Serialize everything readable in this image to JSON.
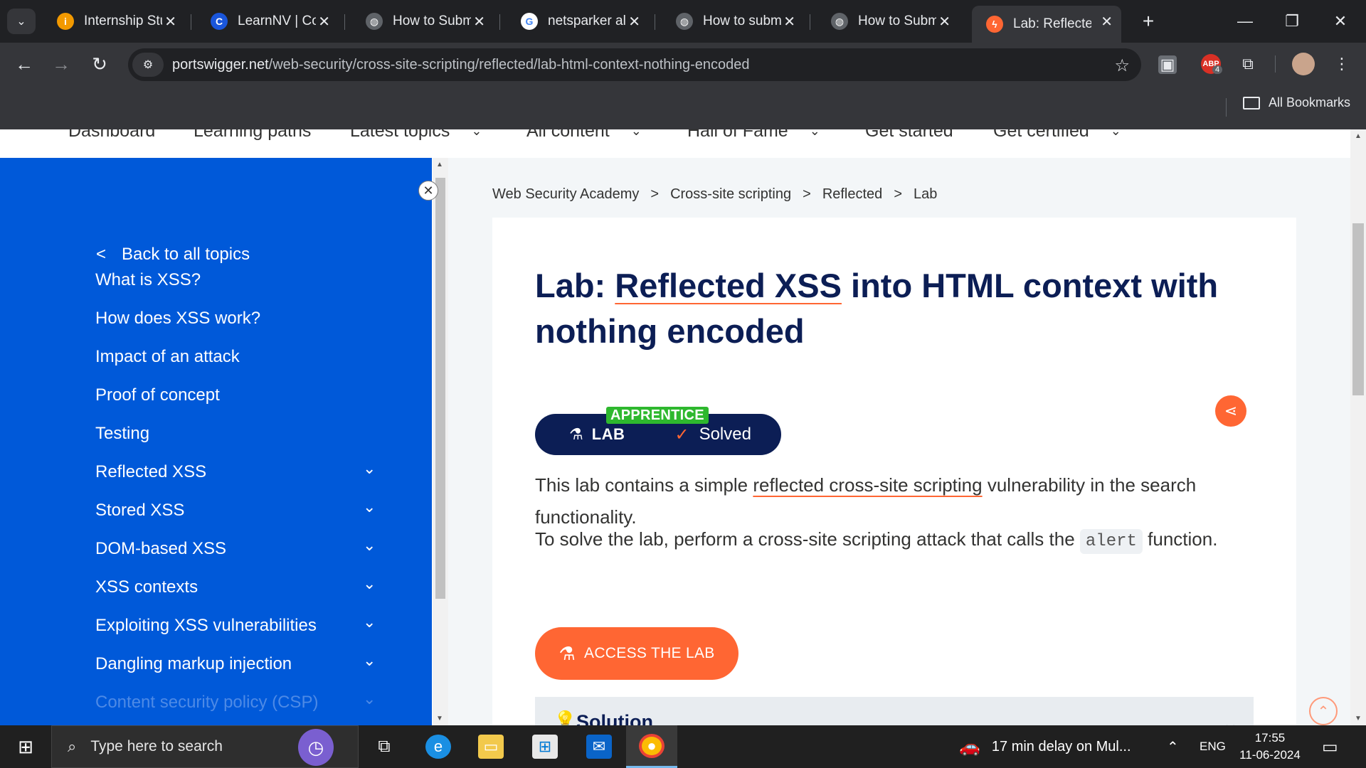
{
  "browser": {
    "tabs": [
      {
        "label": "Internship Stu",
        "icon": "info-icon",
        "color": "#f29900",
        "glyph": "i"
      },
      {
        "label": "LearnNV | Cou",
        "icon": "coursera-icon",
        "color": "#1a56db",
        "glyph": "C"
      },
      {
        "label": "How to Submi",
        "icon": "globe-icon",
        "color": "#5f6368",
        "glyph": "◍"
      },
      {
        "label": "netsparker alt",
        "icon": "google-icon",
        "color": "#ffffff",
        "glyph": "G"
      },
      {
        "label": "How to submi",
        "icon": "globe-icon",
        "color": "#5f6368",
        "glyph": "◍"
      },
      {
        "label": "How to Submi",
        "icon": "globe-icon",
        "color": "#5f6368",
        "glyph": "◍"
      },
      {
        "label": "Lab: Reflected",
        "icon": "portswigger-icon",
        "color": "#ff6633",
        "glyph": "ϟ",
        "active": true
      }
    ],
    "url_host": "portswigger.net",
    "url_path": "/web-security/cross-site-scripting/reflected/lab-html-context-nothing-encoded",
    "ext_badge": "4",
    "bookmarks_label": "All Bookmarks"
  },
  "topnav": [
    {
      "label": "Dashboard",
      "dropdown": false
    },
    {
      "label": "Learning paths",
      "dropdown": false
    },
    {
      "label": "Latest topics",
      "dropdown": true
    },
    {
      "label": "All content",
      "dropdown": true
    },
    {
      "label": "Hall of Fame",
      "dropdown": true
    },
    {
      "label": "Get started",
      "dropdown": false
    },
    {
      "label": "Get certified",
      "dropdown": true
    }
  ],
  "sidebar": {
    "back_label": "Back to all topics",
    "items": [
      {
        "label": "What is XSS?",
        "expandable": false
      },
      {
        "label": "How does XSS work?",
        "expandable": false
      },
      {
        "label": "Impact of an attack",
        "expandable": false
      },
      {
        "label": "Proof of concept",
        "expandable": false
      },
      {
        "label": "Testing",
        "expandable": false
      },
      {
        "label": "Reflected XSS",
        "expandable": true
      },
      {
        "label": "Stored XSS",
        "expandable": true
      },
      {
        "label": "DOM-based XSS",
        "expandable": true
      },
      {
        "label": "XSS contexts",
        "expandable": true
      },
      {
        "label": "Exploiting XSS vulnerabilities",
        "expandable": true
      },
      {
        "label": "Dangling markup injection",
        "expandable": true
      },
      {
        "label": "Content security policy (CSP)",
        "expandable": true
      }
    ]
  },
  "breadcrumb": [
    "Web Security Academy",
    "Cross-site scripting",
    "Reflected",
    "Lab"
  ],
  "breadcrumb_sep": ">",
  "lab": {
    "title_prefix": "Lab: ",
    "title_link": "Reflected XSS",
    "title_rest": " into HTML context with nothing encoded",
    "level": "APPRENTICE",
    "pill_label": "LAB",
    "status": "Solved",
    "desc_before": "This lab contains a simple ",
    "desc_link": "reflected cross-site scripting",
    "desc_after": " vulnerability in the search functionality.",
    "task_before": "To solve the lab, perform a cross-site scripting attack that calls the ",
    "task_code": "alert",
    "task_after": " function.",
    "access_label": "ACCESS THE LAB",
    "solution_label": "Solution"
  },
  "taskbar": {
    "search_placeholder": "Type here to search",
    "notification": "17 min delay on Mul...",
    "language": "ENG",
    "time": "17:55",
    "date": "11-06-2024"
  },
  "colors": {
    "sidebar_blue": "#0059d9",
    "title_navy": "#0c1e55",
    "accent_orange": "#ff6633",
    "apprentice_green": "#2eb82e"
  }
}
